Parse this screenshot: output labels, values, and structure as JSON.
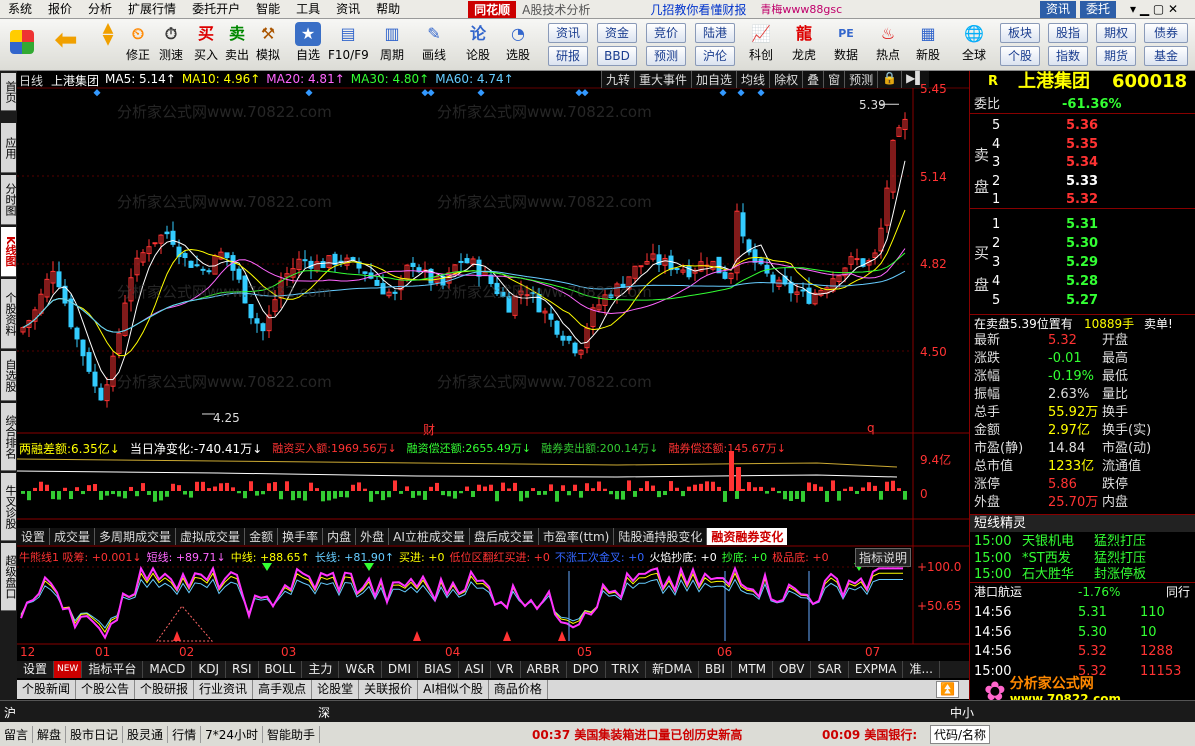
{
  "menu": {
    "items": [
      "系统",
      "报价",
      "分析",
      "扩展行情",
      "委托开户",
      "智能",
      "工具",
      "资讯",
      "帮助"
    ],
    "brand": "同花顺",
    "brand_sub": "A股技术分析",
    "promo": "几招教你看懂财报",
    "promo2": "青梅www88gsc",
    "right": [
      "资讯",
      "委托"
    ]
  },
  "toolbar": {
    "buttons": [
      "修正",
      "测速",
      "买入",
      "卖出",
      "模拟",
      "自选",
      "F10/F9",
      "周期",
      "画线",
      "论股",
      "选股",
      "科创",
      "龙虎",
      "数据",
      "热点",
      "新股",
      "全球"
    ],
    "right_top": [
      "资讯",
      "资金",
      "竞价",
      "陆港",
      "板块",
      "股指",
      "期权",
      "债券"
    ],
    "right_bottom": [
      "研报",
      "BBD",
      "预测",
      "沪伦",
      "个股",
      "指数",
      "期货",
      "基金"
    ]
  },
  "left_tabs": [
    "首页",
    "应用",
    "分时图",
    "K线图",
    "个股资料",
    "自选股",
    "综合排名",
    "牛叉诊股",
    "超级盘口"
  ],
  "chart": {
    "period": "日线",
    "stock": "上港集团",
    "ma": [
      {
        "label": "MA5: 5.14↑",
        "color": "#ffffff"
      },
      {
        "label": "MA10: 4.96↑",
        "color": "#ffff00"
      },
      {
        "label": "MA20: 4.81↑",
        "color": "#ff66ff"
      },
      {
        "label": "MA30: 4.80↑",
        "color": "#33ff33"
      },
      {
        "label": "MA60: 4.74↑",
        "color": "#66ccff"
      }
    ],
    "tools": [
      "九转",
      "重大事件",
      "加自选",
      "均线",
      "除权",
      "叠",
      "窗",
      "预测"
    ],
    "price_labels": [
      "5.45",
      "5.14",
      "4.82",
      "4.50"
    ],
    "high_label": "5.39",
    "low_label": "4.25",
    "cai": "财",
    "q": "q",
    "margin_header": [
      {
        "t": "两融差额:6.35亿↓",
        "c": "#ffff00"
      },
      {
        "t": "当日净变化:-740.41万↓",
        "c": "#ffffff"
      },
      {
        "t": "融资买入额:1969.56万↓",
        "c": "#ff3333"
      },
      {
        "t": "融资偿还额:2655.49万↓",
        "c": "#33ff33"
      },
      {
        "t": "融券卖出额:200.14万↓",
        "c": "#33cc33"
      },
      {
        "t": "融券偿还额:145.67万↓",
        "c": "#ff3333"
      }
    ],
    "margin_labels": [
      "9.4亿",
      "0"
    ],
    "tabs": [
      "设置",
      "成交量",
      "多周期成交量",
      "虚拟成交量",
      "金额",
      "换手率",
      "内盘",
      "外盘",
      "AI立桩成交量",
      "盘后成交量",
      "市盈率(ttm)",
      "陆股通持股变化",
      "融资融券变化"
    ],
    "ind_header": [
      {
        "t": "牛熊线1 吸筹: +0.001↓",
        "c": "#ff3333"
      },
      {
        "t": "短线: +89.71↓",
        "c": "#ff66ff"
      },
      {
        "t": "中线: +88.65↑",
        "c": "#ffff00"
      },
      {
        "t": "长线: +81.90↑",
        "c": "#66ccff"
      },
      {
        "t": "买进: +0",
        "c": "#ffff00"
      },
      {
        "t": "低位区翻红买进: +0",
        "c": "#ff3333"
      },
      {
        "t": "不涨工次金叉: +0",
        "c": "#3366ff"
      },
      {
        "t": "火焰抄底: +0",
        "c": "#ffffff"
      },
      {
        "t": "抄底: +0",
        "c": "#33ff33"
      },
      {
        "t": "极品底: +0",
        "c": "#ff3333"
      }
    ],
    "ind_button": "指标说明",
    "ind_labels": [
      "+100.0",
      "+50.65"
    ],
    "months": [
      "12",
      "01",
      "02",
      "03",
      "04",
      "05",
      "06",
      "07"
    ]
  },
  "bottom_tabs": [
    "设置",
    "NEW",
    "指标平台",
    "MACD",
    "KDJ",
    "RSI",
    "BOLL",
    "主力",
    "W&R",
    "DMI",
    "BIAS",
    "ASI",
    "VR",
    "ARBR",
    "DPO",
    "TRIX",
    "新DMA",
    "BBI",
    "MTM",
    "OBV",
    "SAR",
    "EXPMA",
    "准..."
  ],
  "info_tabs": [
    "个股新闻",
    "个股公告",
    "个股研报",
    "行业资讯",
    "高手观点",
    "论股堂",
    "关联报价",
    "AI相似个股",
    "商品价格"
  ],
  "quote": {
    "name": "上港集团",
    "code": "600018",
    "ratio_label": "委比",
    "ratio": "-61.36%",
    "sell": [
      [
        "5",
        "5.36"
      ],
      [
        "4",
        "5.35"
      ],
      [
        "3",
        "5.34"
      ],
      [
        "2",
        "5.33"
      ],
      [
        "1",
        "5.32"
      ]
    ],
    "sell_side": "卖盘",
    "buy": [
      [
        "1",
        "5.31"
      ],
      [
        "2",
        "5.30"
      ],
      [
        "3",
        "5.29"
      ],
      [
        "4",
        "5.28"
      ],
      [
        "5",
        "5.27"
      ]
    ],
    "buy_side": "买盘",
    "notice": "在卖盘5.39位置有",
    "notice_vol": "10889手",
    "notice_tail": "卖单!",
    "stats": [
      [
        "最新",
        "5.32",
        "开盘",
        ""
      ],
      [
        "涨跌",
        "-0.01",
        "最高",
        ""
      ],
      [
        "涨幅",
        "-0.19%",
        "最低",
        ""
      ],
      [
        "振幅",
        "2.63%",
        "量比",
        ""
      ],
      [
        "总手",
        "55.92万",
        "换手",
        ""
      ],
      [
        "金额",
        "2.97亿",
        "换手(实)",
        ""
      ],
      [
        "市盈(静)",
        "14.84",
        "市盈(动)",
        ""
      ],
      [
        "总市值",
        "1233亿",
        "流通值",
        ""
      ],
      [
        "涨停",
        "5.86",
        "跌停",
        ""
      ],
      [
        "外盘",
        "25.70万",
        "内盘",
        ""
      ]
    ],
    "elves_title": "短线精灵",
    "elves": [
      [
        "15:00",
        "天银机电",
        "猛烈打压"
      ],
      [
        "15:00",
        "*ST西发",
        "猛烈打压"
      ],
      [
        "15:00",
        "石大胜华",
        "封涨停板"
      ]
    ],
    "sector": "港口航运",
    "sector_chg": "-1.76%",
    "sector_tail": "同行",
    "ticks": [
      [
        "14:56",
        "5.31",
        "110"
      ],
      [
        "14:56",
        "5.30",
        "10"
      ],
      [
        "14:56",
        "5.32",
        "1288"
      ],
      [
        "15:00",
        "5.32",
        "11153"
      ]
    ]
  },
  "status": {
    "sh": "沪",
    "sz": "深",
    "zx": "中小"
  },
  "status2": {
    "items": [
      "留言",
      "解盘",
      "股市日记",
      "股灵通",
      "行情",
      "7*24小时",
      "智能助手"
    ],
    "news1": "00:37 美国集装箱进口量已创历史新高",
    "news2": "00:09 美国银行:",
    "code_hint": "代码/名称"
  },
  "watermark": "分析家公式网www.70822.com",
  "logo": {
    "name": "分析家公式网",
    "url": "www.70822.com"
  }
}
